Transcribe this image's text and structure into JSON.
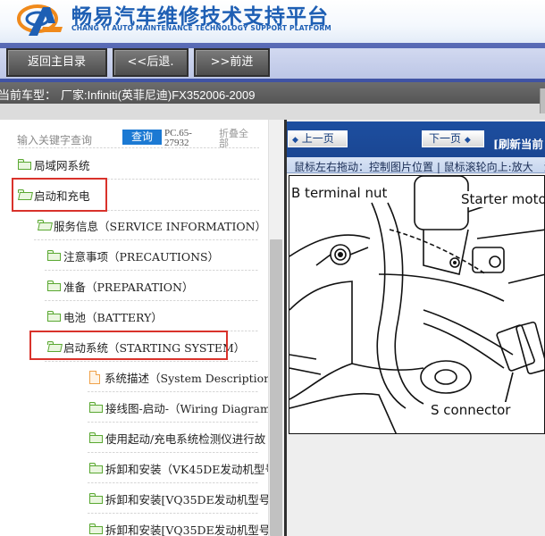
{
  "header": {
    "title": "畅易汽车维修技术支持平台",
    "subtitle": "CHANG YI AUTO MAINTENANCE TECHNOLOGY SUPPORT PLATFORM"
  },
  "nav": {
    "back_home": "返回主目录",
    "back": "<<后退.",
    "forward": ">>前进"
  },
  "info": {
    "label": "当前车型：",
    "value": "厂家:Infiniti(英菲尼迪)FX352006-2009"
  },
  "tree_toolbar": {
    "search_hint": "输入关键字查询",
    "query_button": "查询",
    "pc_code": "PC.65-27932",
    "collapse_all": "折叠全部"
  },
  "tree": [
    {
      "label": "局域网系统",
      "icon": "folder-icon"
    },
    {
      "label": "启动和充电",
      "icon": "folder-open-icon",
      "highlighted": true
    },
    {
      "label": "服务信息（SERVICE INFORMATION）",
      "icon": "folder-open-icon"
    },
    {
      "label": "注意事项（PRECAUTIONS）",
      "icon": "folder-icon"
    },
    {
      "label": "准备（PREPARATION）",
      "icon": "folder-icon"
    },
    {
      "label": "电池（BATTERY）",
      "icon": "folder-icon"
    },
    {
      "label": "启动系统（STARTING SYSTEM）",
      "icon": "folder-open-icon",
      "highlighted": true
    },
    {
      "label": "系统描述（System Description）",
      "icon": "document-icon"
    },
    {
      "label": "接线图-启动-（Wiring Diagram -",
      "icon": "folder-icon"
    },
    {
      "label": "使用起动/充电系统检测仪进行故",
      "icon": "folder-icon"
    },
    {
      "label": "拆卸和安装（VK45DE发动机型号",
      "icon": "folder-icon"
    },
    {
      "label": "拆卸和安装[VQ35DE发动机型号",
      "icon": "folder-icon"
    },
    {
      "label": "拆卸和安装[VQ35DE发动机型号",
      "icon": "folder-icon"
    }
  ],
  "viewer": {
    "prev_page": "上一页",
    "next_page": "下一页",
    "refresh": "[刷新当前",
    "hint": "鼠标左右拖动：控制图片位置 | 鼠标滚轮向上:放大　滚",
    "diagram_labels": {
      "b_terminal": "B terminal nut",
      "starter_motor": "Starter motor",
      "s_connector": "S connector"
    }
  },
  "colors": {
    "brand_blue": "#1e5fb4",
    "nav_blue": "#4a5daa",
    "viewer_blue": "#1d4fa0",
    "folder_green": "#5aa832",
    "highlight_red": "#d9322b",
    "query_blue": "#1b79d3"
  }
}
